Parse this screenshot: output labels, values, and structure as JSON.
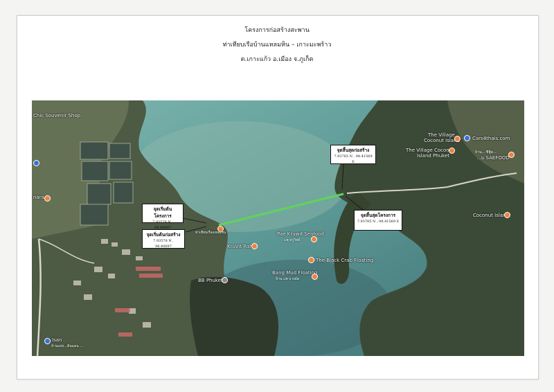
{
  "header": {
    "line1": "โครงการก่อสร้างสะพาน",
    "line2": "ท่าเทียบเรือบ้านแหลมหิน – เกาะมะพร้าว",
    "line3": "ต.เกาะแก้ว อ.เมือง จ.ภูเก็ต"
  },
  "callouts": [
    {
      "title": "จุดเริ่มต้นโครงการ",
      "coord": "7.93578 N , 98.40697"
    },
    {
      "title": "จุดเริ่มต้นก่อสร้าง",
      "coord": "7.93578 N , 98.40697"
    },
    {
      "title": "จุดสิ้นสุดก่อสร้าง",
      "coord": "7.93785 N , 98.41569 E"
    },
    {
      "title": "จุดสิ้นสุดโครงการ",
      "coord": "7.93785 N , 98.41569 E"
    }
  ],
  "places": {
    "souvenir": "Chic Souvenir Shop",
    "village1a": "The Village",
    "village1b": "Coconut Island",
    "cars": "Cars4thais.com",
    "village2a": "The Village Coconut",
    "village2b": "Island Phuket",
    "seafood_a": "บ้าน... ซีฟู้ด...",
    "seafood_b": "...ม SAEFOOD",
    "coconut": "Coconut Island",
    "kruvit_raft": "KruVit Raft",
    "pae_kruwit_a": "Pae Kruwit Seafood",
    "pae_kruwit_b": "แพ ครูวิทย์",
    "black_crab": "The Black Crab Floating",
    "bang_mud_a": "Bang Mud Floating",
    "bang_mud_b": "บ้าน แพ บางมัด",
    "bb_phuket": "BB Phuket",
    "laem_hin": "ท่าเทียบเรือแหลมหิน",
    "isan": "Isan",
    "isan_sub": "บ้านแห่ง...ดินแดน ...",
    "road": "ถนน...",
    "left_label": "nara"
  },
  "colors": {
    "water": "#4f8a88",
    "bridge": "#5fd45a",
    "pin": "#f1813a"
  }
}
